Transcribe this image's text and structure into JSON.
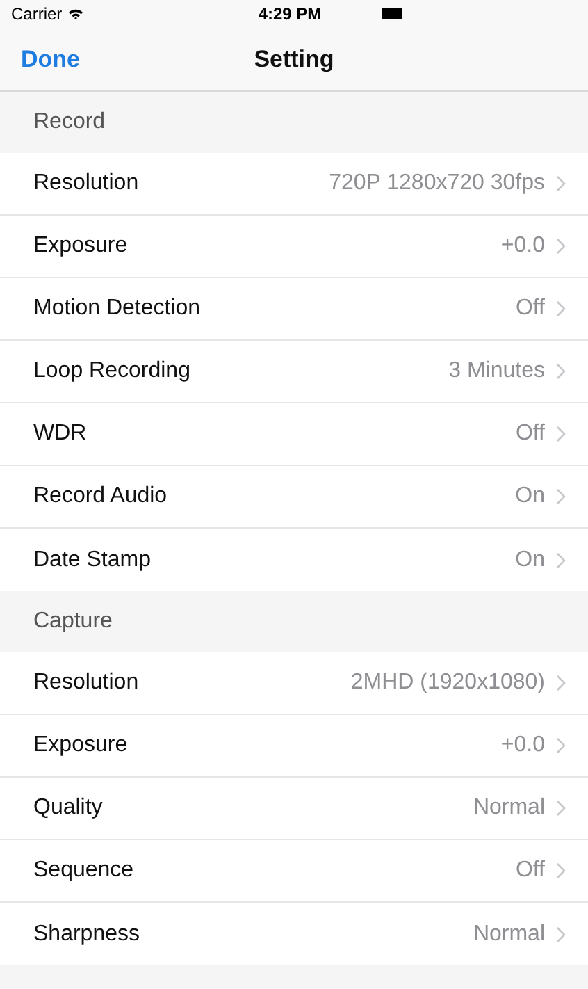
{
  "status_bar": {
    "carrier": "Carrier",
    "time": "4:29 PM"
  },
  "nav_bar": {
    "left_button": "Done",
    "title": "Setting"
  },
  "sections": [
    {
      "header": "Record",
      "rows": [
        {
          "label": "Resolution",
          "value": "720P 1280x720 30fps"
        },
        {
          "label": "Exposure",
          "value": "+0.0"
        },
        {
          "label": "Motion Detection",
          "value": "Off"
        },
        {
          "label": "Loop Recording",
          "value": "3 Minutes"
        },
        {
          "label": "WDR",
          "value": "Off"
        },
        {
          "label": "Record Audio",
          "value": "On"
        },
        {
          "label": "Date Stamp",
          "value": "On"
        }
      ]
    },
    {
      "header": "Capture",
      "rows": [
        {
          "label": "Resolution",
          "value": "2MHD (1920x1080)"
        },
        {
          "label": "Exposure",
          "value": "+0.0"
        },
        {
          "label": "Quality",
          "value": "Normal"
        },
        {
          "label": "Sequence",
          "value": "Off"
        },
        {
          "label": "Sharpness",
          "value": "Normal"
        }
      ]
    }
  ]
}
